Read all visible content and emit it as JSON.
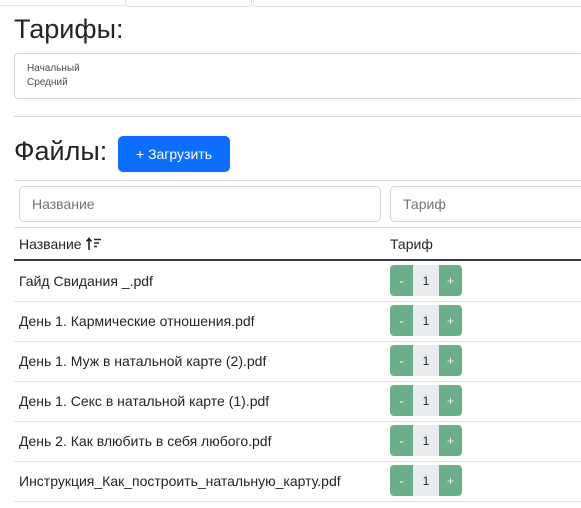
{
  "tariffs": {
    "heading": "Тарифы:",
    "options": [
      "Начальный",
      "Средний"
    ]
  },
  "files": {
    "heading": "Файлы:",
    "upload_label": "+ Загрузить"
  },
  "filters": {
    "name_placeholder": "Название",
    "tariff_placeholder": "Тариф"
  },
  "table": {
    "col_name": "Название",
    "col_tariff": "Тариф",
    "rows": [
      {
        "name": "Гайд Свидания _.pdf",
        "value": "1"
      },
      {
        "name": "День 1. Кармические отношения.pdf",
        "value": "1"
      },
      {
        "name": "День 1. Муж в натальной карте (2).pdf",
        "value": "1"
      },
      {
        "name": "День 1. Секс в натальной карте (1).pdf",
        "value": "1"
      },
      {
        "name": "День 2. Как влюбить в себя любого.pdf",
        "value": "1"
      },
      {
        "name": "Инструкция_Как_построить_натальную_карту.pdf",
        "value": "1"
      }
    ],
    "stepper": {
      "minus": "-",
      "plus": "+"
    }
  },
  "icons": {
    "sort": "sort-ascending-icon"
  },
  "colors": {
    "primary": "#0d6efd",
    "stepper": "#6aae8a"
  }
}
